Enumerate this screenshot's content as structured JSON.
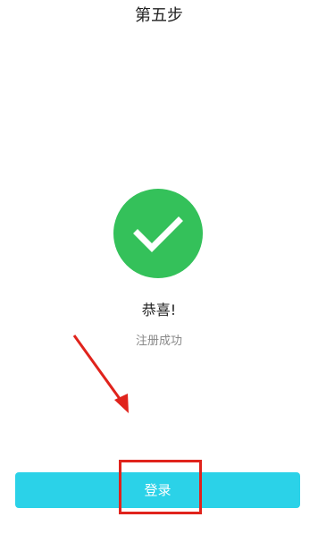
{
  "header": {
    "step_title": "第五步"
  },
  "result": {
    "icon": "check-circle-icon",
    "icon_color": "#34c15a",
    "title": "恭喜!",
    "message": "注册成功"
  },
  "actions": {
    "login_label": "登录",
    "login_color": "#2bd2e8"
  },
  "annotation": {
    "arrow_color": "#e0231c",
    "highlight_color": "#e0231c"
  }
}
